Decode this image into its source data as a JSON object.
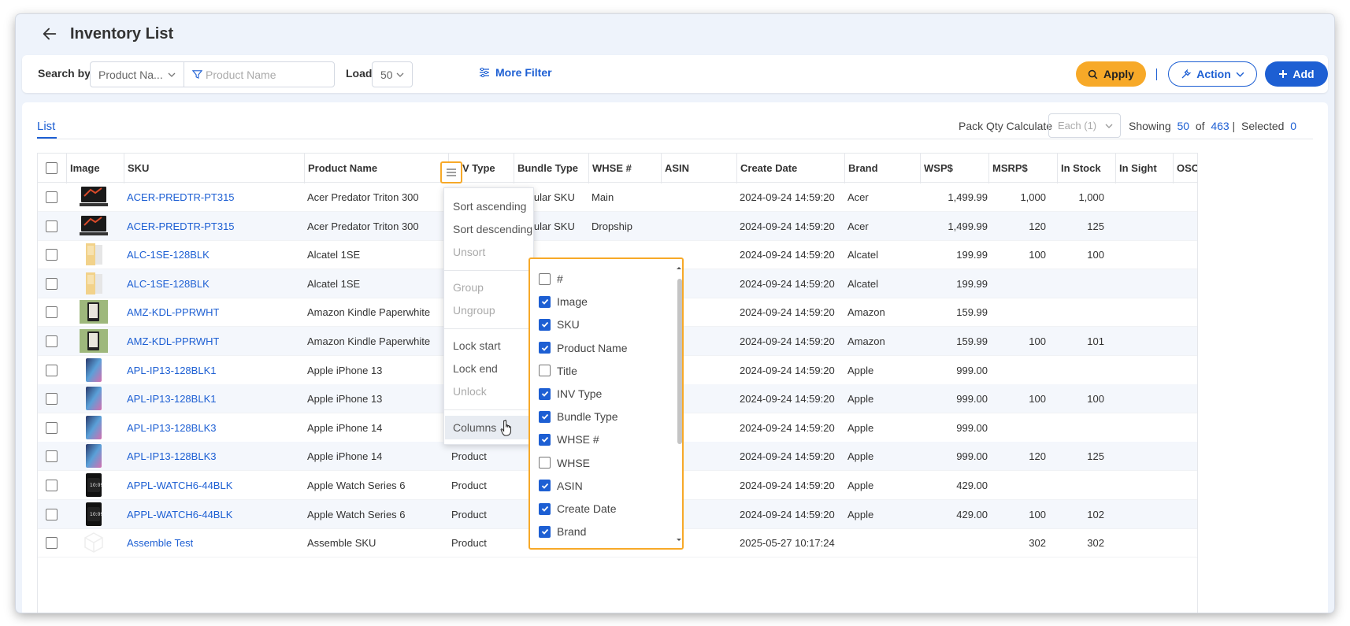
{
  "header": {
    "title": "Inventory List"
  },
  "filters": {
    "search_by_label": "Search by",
    "search_field_value": "Product Na...",
    "search_placeholder": "Product Name",
    "load_label": "Load",
    "load_value": "50",
    "more_filter_label": "More Filter",
    "apply_label": "Apply",
    "action_label": "Action",
    "add_label": "Add"
  },
  "list": {
    "tab_label": "List",
    "pack_qty_label": "Pack Qty Calculate",
    "pack_qty_value": "Each (1)",
    "showing_label": "Showing",
    "showing_count": "50",
    "of_label": "of",
    "total_count": "463",
    "selected_label": "Selected",
    "selected_count": "0"
  },
  "columns": [
    "Image",
    "SKU",
    "Product Name",
    "INV Type",
    "Bundle Type",
    "WHSE #",
    "ASIN",
    "Create Date",
    "Brand",
    "WSP$",
    "MSRP$",
    "In Stock",
    "In Sight",
    "OSO"
  ],
  "rows": [
    {
      "sku": "ACER-PREDTR-PT315",
      "name": "Acer Predator Triton 300",
      "inv": "",
      "bundle": "Regular SKU",
      "whse": "Main",
      "date": "2024-09-24 14:59:20",
      "brand": "Acer",
      "msrp": "1,499.99",
      "stock": "1,000",
      "sight": "1,000",
      "thumb": "laptop"
    },
    {
      "sku": "ACER-PREDTR-PT315",
      "name": "Acer Predator Triton 300",
      "inv": "",
      "bundle": "Regular SKU",
      "whse": "Dropship",
      "date": "2024-09-24 14:59:20",
      "brand": "Acer",
      "msrp": "1,499.99",
      "stock": "120",
      "sight": "125",
      "thumb": "laptop"
    },
    {
      "sku": "ALC-1SE-128BLK",
      "name": "Alcatel 1SE",
      "inv": "",
      "bundle": "",
      "whse": "",
      "date": "2024-09-24 14:59:20",
      "brand": "Alcatel",
      "msrp": "199.99",
      "stock": "100",
      "sight": "100",
      "thumb": "phonebox"
    },
    {
      "sku": "ALC-1SE-128BLK",
      "name": "Alcatel 1SE",
      "inv": "",
      "bundle": "",
      "whse": "",
      "date": "2024-09-24 14:59:20",
      "brand": "Alcatel",
      "msrp": "199.99",
      "stock": "",
      "sight": "",
      "thumb": "phonebox"
    },
    {
      "sku": "AMZ-KDL-PPRWHT",
      "name": "Amazon Kindle Paperwhite",
      "inv": "",
      "bundle": "",
      "whse": "",
      "date": "2024-09-24 14:59:20",
      "brand": "Amazon",
      "msrp": "159.99",
      "stock": "",
      "sight": "",
      "thumb": "kindle"
    },
    {
      "sku": "AMZ-KDL-PPRWHT",
      "name": "Amazon Kindle Paperwhite",
      "inv": "",
      "bundle": "",
      "whse": "",
      "date": "2024-09-24 14:59:20",
      "brand": "Amazon",
      "msrp": "159.99",
      "stock": "100",
      "sight": "101",
      "thumb": "kindle"
    },
    {
      "sku": "APL-IP13-128BLK1",
      "name": "Apple iPhone 13",
      "inv": "",
      "bundle": "",
      "whse": "",
      "date": "2024-09-24 14:59:20",
      "brand": "Apple",
      "msrp": "999.00",
      "stock": "",
      "sight": "",
      "thumb": "iphone"
    },
    {
      "sku": "APL-IP13-128BLK1",
      "name": "Apple iPhone 13",
      "inv": "",
      "bundle": "",
      "whse": "",
      "date": "2024-09-24 14:59:20",
      "brand": "Apple",
      "msrp": "999.00",
      "stock": "100",
      "sight": "100",
      "thumb": "iphone"
    },
    {
      "sku": "APL-IP13-128BLK3",
      "name": "Apple iPhone 14",
      "inv": "",
      "bundle": "",
      "whse": "",
      "date": "2024-09-24 14:59:20",
      "brand": "Apple",
      "msrp": "999.00",
      "stock": "",
      "sight": "",
      "thumb": "iphone"
    },
    {
      "sku": "APL-IP13-128BLK3",
      "name": "Apple iPhone 14",
      "inv": "Product",
      "bundle": "",
      "whse": "",
      "date": "2024-09-24 14:59:20",
      "brand": "Apple",
      "msrp": "999.00",
      "stock": "120",
      "sight": "125",
      "thumb": "iphone"
    },
    {
      "sku": "APPL-WATCH6-44BLK",
      "name": "Apple Watch Series 6",
      "inv": "Product",
      "bundle": "",
      "whse": "",
      "date": "2024-09-24 14:59:20",
      "brand": "Apple",
      "msrp": "429.00",
      "stock": "",
      "sight": "",
      "thumb": "watch"
    },
    {
      "sku": "APPL-WATCH6-44BLK",
      "name": "Apple Watch Series 6",
      "inv": "Product",
      "bundle": "",
      "whse": "",
      "date": "2024-09-24 14:59:20",
      "brand": "Apple",
      "msrp": "429.00",
      "stock": "100",
      "sight": "102",
      "thumb": "watch"
    },
    {
      "sku": "Assemble Test",
      "name": "Assemble SKU",
      "inv": "Product",
      "bundle": "",
      "whse": "",
      "date": "2025-05-27 10:17:24",
      "brand": "",
      "msrp": "",
      "stock": "302",
      "sight": "302",
      "thumb": "cube"
    }
  ],
  "column_menu": {
    "items": [
      "Sort ascending",
      "Sort descending",
      "Unsort",
      "Group",
      "Ungroup",
      "Lock start",
      "Lock end",
      "Unlock",
      "Columns"
    ]
  },
  "column_chooser": [
    {
      "label": "#",
      "checked": false
    },
    {
      "label": "Image",
      "checked": true
    },
    {
      "label": "SKU",
      "checked": true
    },
    {
      "label": "Product Name",
      "checked": true
    },
    {
      "label": "Title",
      "checked": false
    },
    {
      "label": "INV Type",
      "checked": true
    },
    {
      "label": "Bundle Type",
      "checked": true
    },
    {
      "label": "WHSE #",
      "checked": true
    },
    {
      "label": "WHSE",
      "checked": false
    },
    {
      "label": "ASIN",
      "checked": true
    },
    {
      "label": "Create Date",
      "checked": true
    },
    {
      "label": "Brand",
      "checked": true
    }
  ],
  "colors": {
    "accent": "#1d5fd3",
    "apply": "#f7a928",
    "highlight": "#f7a928"
  }
}
